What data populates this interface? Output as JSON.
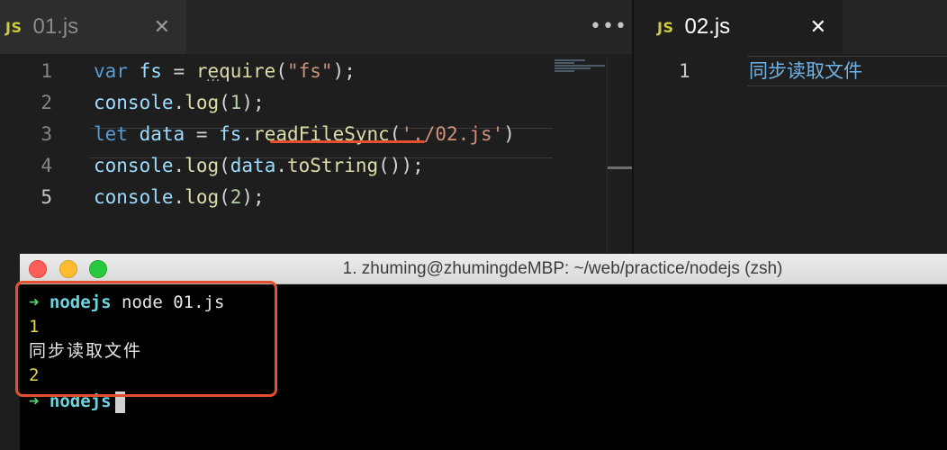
{
  "editor_left": {
    "tab": {
      "badge": "JS",
      "name": "01.js",
      "close": "✕"
    },
    "more_actions": "•••",
    "lines": [
      {
        "number": "1",
        "tokens": [
          {
            "t": "var",
            "c": "kw"
          },
          {
            "t": " ",
            "c": "plain"
          },
          {
            "t": "fs",
            "c": "var"
          },
          {
            "t": " = ",
            "c": "plain"
          },
          {
            "t": "require",
            "c": "fn"
          },
          {
            "t": "(",
            "c": "plain"
          },
          {
            "t": "\"fs\"",
            "c": "str"
          },
          {
            "t": ");",
            "c": "plain"
          }
        ]
      },
      {
        "number": "2",
        "tokens": [
          {
            "t": "console",
            "c": "var"
          },
          {
            "t": ".",
            "c": "plain"
          },
          {
            "t": "log",
            "c": "fn"
          },
          {
            "t": "(",
            "c": "plain"
          },
          {
            "t": "1",
            "c": "num"
          },
          {
            "t": ");",
            "c": "plain"
          }
        ]
      },
      {
        "number": "3",
        "tokens": [
          {
            "t": "let",
            "c": "kw"
          },
          {
            "t": " ",
            "c": "plain"
          },
          {
            "t": "data",
            "c": "var"
          },
          {
            "t": " = ",
            "c": "plain"
          },
          {
            "t": "fs",
            "c": "var"
          },
          {
            "t": ".",
            "c": "plain"
          },
          {
            "t": "readFileSync",
            "c": "fn"
          },
          {
            "t": "(",
            "c": "plain"
          },
          {
            "t": "'./02.js'",
            "c": "str"
          },
          {
            "t": ")",
            "c": "plain"
          }
        ]
      },
      {
        "number": "4",
        "tokens": [
          {
            "t": "console",
            "c": "var"
          },
          {
            "t": ".",
            "c": "plain"
          },
          {
            "t": "log",
            "c": "fn"
          },
          {
            "t": "(",
            "c": "plain"
          },
          {
            "t": "data",
            "c": "var"
          },
          {
            "t": ".",
            "c": "plain"
          },
          {
            "t": "toString",
            "c": "fn"
          },
          {
            "t": "());",
            "c": "plain"
          }
        ]
      },
      {
        "number": "5",
        "active": true,
        "tokens": [
          {
            "t": "console",
            "c": "var"
          },
          {
            "t": ".",
            "c": "plain"
          },
          {
            "t": "log",
            "c": "fn"
          },
          {
            "t": "(",
            "c": "plain"
          },
          {
            "t": "2",
            "c": "num"
          },
          {
            "t": ");",
            "c": "plain"
          }
        ]
      }
    ]
  },
  "editor_right": {
    "tab": {
      "badge": "JS",
      "name": "02.js",
      "close": "✕"
    },
    "line_number": "1",
    "content": "同步读取文件"
  },
  "terminal": {
    "title": "1. zhuming@zhumingdeMBP: ~/web/practice/nodejs (zsh)",
    "prompt_arrow": "➜",
    "prompt_dir": "nodejs",
    "command": "node 01.js",
    "output_1": "1",
    "output_2": "同步读取文件",
    "output_3": "2"
  },
  "colors": {
    "highlight": "#e4502f",
    "prompt_arrow": "#52d273",
    "prompt_dir": "#6bd6e0",
    "output_number": "#e6d44b"
  }
}
